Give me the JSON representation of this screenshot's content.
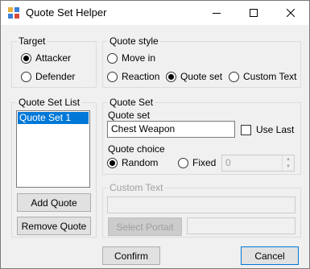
{
  "window": {
    "title": "Quote Set Helper"
  },
  "target": {
    "label": "Target",
    "options": [
      {
        "label": "Attacker",
        "checked": true
      },
      {
        "label": "Defender",
        "checked": false
      }
    ]
  },
  "quote_style": {
    "label": "Quote style",
    "options": [
      {
        "label": "Move in",
        "checked": false
      },
      {
        "label": "Reaction",
        "checked": false
      },
      {
        "label": "Quote set",
        "checked": true
      },
      {
        "label": "Custom Text",
        "checked": false
      }
    ]
  },
  "quote_set_list": {
    "label": "Quote Set List",
    "items": [
      "Quote Set 1"
    ],
    "selected": "Quote Set 1",
    "add_label": "Add Quote",
    "remove_label": "Remove Quote"
  },
  "quote_set": {
    "label": "Quote Set",
    "field_label": "Quote set",
    "value": "Chest Weapon",
    "use_last_label": "Use Last",
    "use_last_checked": false,
    "choice_label": "Quote choice",
    "choices": [
      {
        "label": "Random",
        "checked": true
      },
      {
        "label": "Fixed",
        "checked": false
      }
    ],
    "fixed_value": "0"
  },
  "custom_text": {
    "label": "Custom Text",
    "text_value": "",
    "select_portrait_label": "Select Portait",
    "portrait_value": ""
  },
  "footer": {
    "confirm_label": "Confirm",
    "cancel_label": "Cancel"
  },
  "colors": {
    "selection": "#0078d7",
    "window_bg": "#f0f0f0",
    "disabled_text": "#a0a0a0"
  },
  "icons": {
    "app": "app-window-icon",
    "minimize": "minimize-icon",
    "maximize": "maximize-icon",
    "close": "close-icon"
  }
}
